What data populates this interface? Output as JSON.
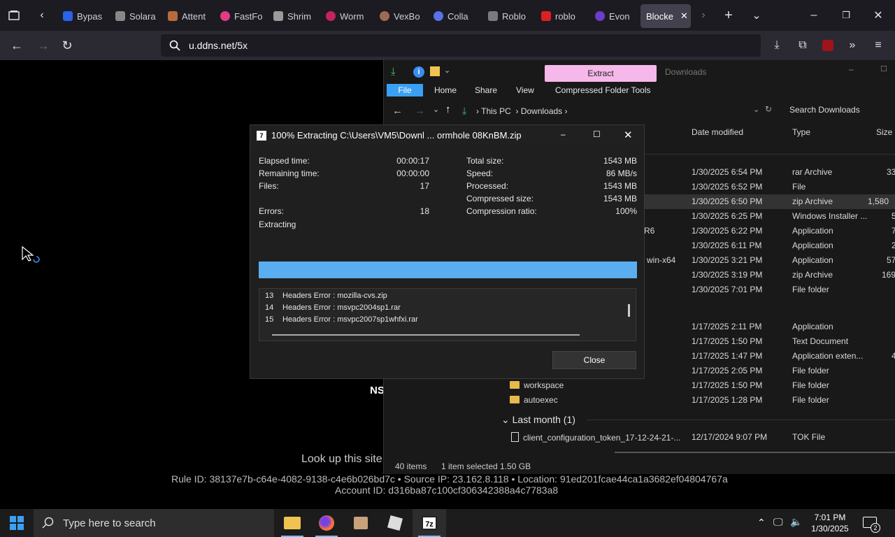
{
  "browser": {
    "tabs": [
      {
        "label": "Bypas",
        "color": "#2a62e8"
      },
      {
        "label": "Solara",
        "color": "#888888"
      },
      {
        "label": "Attent",
        "color": "#b86b3a"
      },
      {
        "label": "FastFo",
        "color": "#e23a86"
      },
      {
        "label": "Shrim",
        "color": "#9a9a9a"
      },
      {
        "label": "Worm",
        "color": "#c4245c"
      },
      {
        "label": "VexBo",
        "color": "#a06a52"
      },
      {
        "label": "Colla",
        "color": "#5a72e8"
      },
      {
        "label": "Roblo",
        "color": "#7a7a80"
      },
      {
        "label": "roblo",
        "color": "#e02020"
      },
      {
        "label": "Evon",
        "color": "#6e3cc8"
      },
      {
        "label": "Blocke",
        "color": "#555555"
      }
    ],
    "url": "u.ddns.net/5x"
  },
  "page": {
    "ns_text": "NS",
    "lookup_text": "Look up this site",
    "rule_line": "Rule ID: 38137e7b-c64e-4082-9138-c4e6b026bd7c • Source IP: 23.162.8.118 • Location: 91ed201fcae44ca1a3682ef04804767a",
    "account_line": "Account ID: d316ba87c100cf306342388a4c7783a8"
  },
  "explorer": {
    "extract_label": "Extract",
    "title": "Downloads",
    "ribbon_tabs": [
      "File",
      "Home",
      "Share",
      "View",
      "Compressed Folder Tools"
    ],
    "breadcrumb": [
      "This PC",
      "Downloads"
    ],
    "search_placeholder": "Search Downloads",
    "columns": {
      "date": "Date modified",
      "type": "Type",
      "size": "Size"
    },
    "rows": [
      {
        "name": "",
        "date": "1/30/2025 6:54 PM",
        "type": "rar Archive",
        "size": "33"
      },
      {
        "name": "",
        "date": "1/30/2025 6:52 PM",
        "type": "File",
        "size": ""
      },
      {
        "name": "",
        "date": "1/30/2025 6:50 PM",
        "type": "zip Archive",
        "size": "1,580"
      },
      {
        "name": "",
        "date": "1/30/2025 6:25 PM",
        "type": "Windows Installer ...",
        "size": "5"
      },
      {
        "name": "R6",
        "date": "1/30/2025 6:22 PM",
        "type": "Application",
        "size": "7"
      },
      {
        "name": "",
        "date": "1/30/2025 6:11 PM",
        "type": "Application",
        "size": "2"
      },
      {
        "name": "win-x64",
        "date": "1/30/2025 3:21 PM",
        "type": "Application",
        "size": "57"
      },
      {
        "name": "",
        "date": "1/30/2025 3:19 PM",
        "type": "zip Archive",
        "size": "169"
      },
      {
        "name": "",
        "date": "1/30/2025 7:01 PM",
        "type": "File folder",
        "size": ""
      }
    ],
    "rows2": [
      {
        "name": "",
        "date": "1/17/2025 2:11 PM",
        "type": "Application",
        "size": ""
      },
      {
        "name": "",
        "date": "1/17/2025 1:50 PM",
        "type": "Text Document",
        "size": ""
      },
      {
        "name": "",
        "date": "1/17/2025 1:47 PM",
        "type": "Application exten...",
        "size": "4"
      },
      {
        "name": "",
        "date": "1/17/2025 2:05 PM",
        "type": "File folder",
        "size": ""
      },
      {
        "name": "workspace",
        "date": "1/17/2025 1:50 PM",
        "type": "File folder",
        "size": ""
      },
      {
        "name": "autoexec",
        "date": "1/17/2025 1:28 PM",
        "type": "File folder",
        "size": ""
      }
    ],
    "group_last_month": "Last month (1)",
    "last_month_row": {
      "name": "client_configuration_token_17-12-24-21-...",
      "date": "12/17/2024 9:07 PM",
      "type": "TOK File"
    },
    "status": {
      "items": "40 items",
      "selected": "1 item selected  1.50 GB"
    }
  },
  "dialog": {
    "title": "100% Extracting C:\\Users\\VM5\\Downl ... ormhole 08KnBM.zip",
    "left_stats": [
      {
        "label": "Elapsed time:",
        "value": "00:00:17"
      },
      {
        "label": "Remaining time:",
        "value": "00:00:00"
      },
      {
        "label": "Files:",
        "value": "17"
      },
      {
        "label": "Errors:",
        "value": "18"
      }
    ],
    "right_stats": [
      {
        "label": "Total size:",
        "value": "1543 MB"
      },
      {
        "label": "Speed:",
        "value": "86 MB/s"
      },
      {
        "label": "Processed:",
        "value": "1543 MB"
      },
      {
        "label": "Compressed size:",
        "value": "1543 MB"
      },
      {
        "label": "Compression ratio:",
        "value": "100%"
      }
    ],
    "status_text": "Extracting",
    "progress": 1.0,
    "log": [
      {
        "n": "13",
        "text": "Headers Error : mozilla-cvs.zip"
      },
      {
        "n": "14",
        "text": "Headers Error : msvpc2004sp1.rar"
      },
      {
        "n": "15",
        "text": "Headers Error : msvpc2007sp1whfxi.rar"
      }
    ],
    "close_label": "Close"
  },
  "taskbar": {
    "search_placeholder": "Type here to search",
    "time": "7:01 PM",
    "date": "1/30/2025",
    "notifications": "2"
  }
}
